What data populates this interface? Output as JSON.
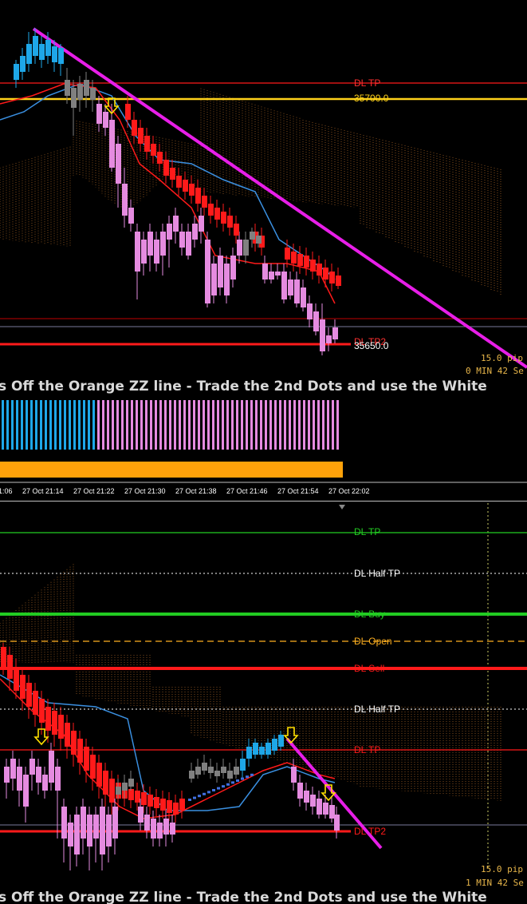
{
  "colors": {
    "background": "#000000",
    "bull_candle": "#1ea7e8",
    "bear_candle": "#e58be0",
    "neutral_candle": "#808080",
    "red_line": "#ff1a1a",
    "yellow_line": "#ffd21a",
    "magenta_trend": "#e81ee8",
    "green_line": "#22cc22",
    "orange_bar": "#ffa20a",
    "blue_ma": "#3a8fe0",
    "cloud": "#c9782b"
  },
  "top_chart": {
    "levels": {
      "dl_tp": "DL TP",
      "price_high": "35700.0",
      "price_low": "35650.0",
      "overlap_label": "DL TP2"
    },
    "info": {
      "pips": "15.0 pip",
      "timer": "0 MIN 42 Se"
    },
    "banner": "s Off the Orange ZZ line - Trade the 2nd Dots and use the White"
  },
  "time_axis": {
    "ticks": [
      "1:06",
      "27 Oct 21:14",
      "27 Oct 21:22",
      "27 Oct 21:30",
      "27 Oct 21:38",
      "27 Oct 21:46",
      "27 Oct 21:54",
      "27 Oct 22:02"
    ]
  },
  "bottom_chart": {
    "levels": {
      "dl_tp": "DL TP",
      "dl_half_tp": "DL Half TP",
      "dl_buy": "DL Buy",
      "dl_open": "DL Open",
      "dl_sell": "DL Sell",
      "dl_half_tp_2": "DL Half TP",
      "dl_tp_red": "DL TP",
      "dl_tp2": "DL TP2"
    },
    "info": {
      "pips": "15.0 pip",
      "timer": "1 MIN 42 Se"
    },
    "banner": "s Off the Orange ZZ line - Trade the 2nd Dots and use the White"
  }
}
